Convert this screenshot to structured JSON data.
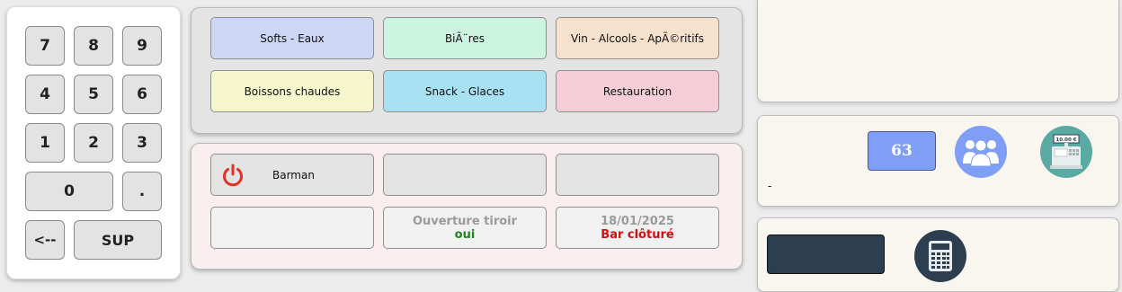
{
  "keypad": {
    "keys": {
      "k7": "7",
      "k8": "8",
      "k9": "9",
      "k4": "4",
      "k5": "5",
      "k6": "6",
      "k1": "1",
      "k2": "2",
      "k3": "3",
      "k0": "0",
      "dot": ".",
      "back": "<--",
      "sup": "SUP"
    }
  },
  "categories": [
    {
      "label": "Softs - Eaux",
      "color": "#ccd6f5"
    },
    {
      "label": "BiÃ¨res",
      "color": "#cdf3e1"
    },
    {
      "label": "Vin - Alcools - ApÃ©ritifs",
      "color": "#f6e1cd"
    },
    {
      "label": "Boissons chaudes",
      "color": "#f5f6cc"
    },
    {
      "label": "Snack - Glaces",
      "color": "#a8e1f2"
    },
    {
      "label": "Restauration",
      "color": "#f4cdd7"
    }
  ],
  "functions": {
    "barman_label": "Barman",
    "drawer_title": "Ouverture tiroir",
    "drawer_value": "oui",
    "date": "18/01/2025",
    "bar_status": "Bar clôturé"
  },
  "colors": {
    "power_icon": "#e0322b",
    "drawer_value": "#1a8a1a",
    "bar_status": "#d01010",
    "counter_badge": "#7f9ef5",
    "people_icon_bg": "#7f9ef5",
    "register_icon_bg": "#5aa9a2",
    "calculator_bg": "#2c3e50",
    "dark_display": "#2c3e50"
  },
  "status": {
    "counter": "63",
    "dash_text": "-",
    "register_amount": "10.00 €"
  }
}
